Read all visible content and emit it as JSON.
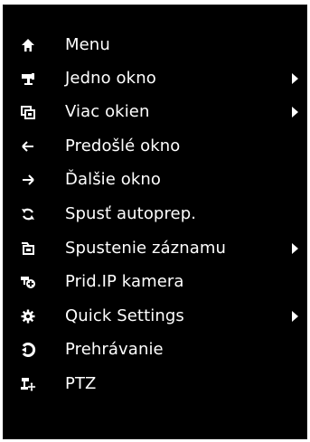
{
  "menu": {
    "items": [
      {
        "label": "Menu",
        "icon": "home-icon",
        "submenu": false
      },
      {
        "label": "Jedno okno",
        "icon": "camera-icon",
        "submenu": true
      },
      {
        "label": "Viac okien",
        "icon": "multi-window-icon",
        "submenu": true
      },
      {
        "label": "Predošlé okno",
        "icon": "arrow-left-icon",
        "submenu": false
      },
      {
        "label": "Ďalšie okno",
        "icon": "arrow-right-icon",
        "submenu": false
      },
      {
        "label": "Spusť autoprep.",
        "icon": "refresh-icon",
        "submenu": false
      },
      {
        "label": "Spustenie záznamu",
        "icon": "record-icon",
        "submenu": true
      },
      {
        "label": "Prid.IP kamera",
        "icon": "add-camera-icon",
        "submenu": false
      },
      {
        "label": "Quick Settings",
        "icon": "gear-icon",
        "submenu": true
      },
      {
        "label": "Prehrávanie",
        "icon": "playback-icon",
        "submenu": false
      },
      {
        "label": "PTZ",
        "icon": "ptz-icon",
        "submenu": false
      }
    ]
  },
  "colors": {
    "background": "#000000",
    "text": "#ffffff"
  }
}
